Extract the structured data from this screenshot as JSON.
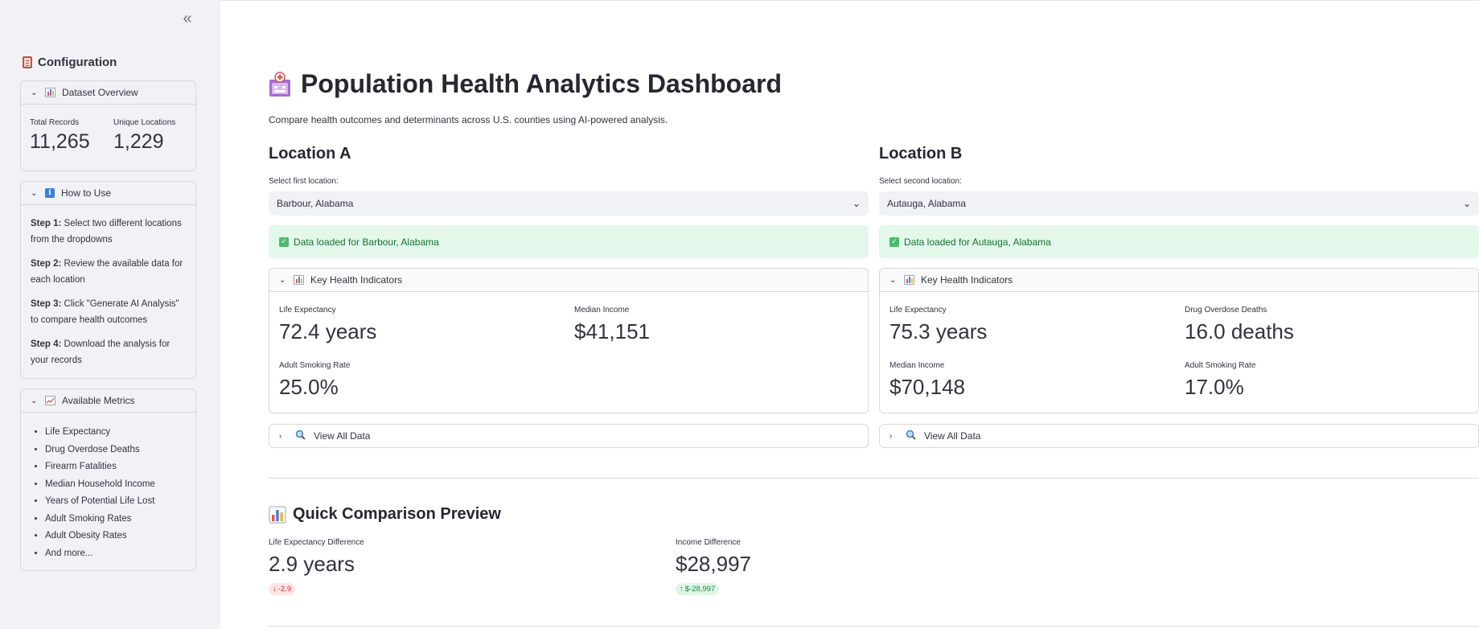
{
  "sidebar": {
    "collapse_icon": "double-chevron-left-icon",
    "title": "Configuration",
    "dataset": {
      "header": "Dataset Overview",
      "metrics": [
        {
          "label": "Total Records",
          "value": "11,265"
        },
        {
          "label": "Unique Locations",
          "value": "1,229"
        }
      ]
    },
    "how_to": {
      "header": "How to Use",
      "steps": [
        {
          "label": "Step 1:",
          "text": "Select two different locations from the dropdowns"
        },
        {
          "label": "Step 2:",
          "text": "Review the available data for each location"
        },
        {
          "label": "Step 3:",
          "text": "Click \"Generate AI Analysis\" to compare health outcomes"
        },
        {
          "label": "Step 4:",
          "text": "Download the analysis for your records"
        }
      ]
    },
    "metrics_list": {
      "header": "Available Metrics",
      "items": [
        "Life Expectancy",
        "Drug Overdose Deaths",
        "Firearm Fatalities",
        "Median Household Income",
        "Years of Potential Life Lost",
        "Adult Smoking Rates",
        "Adult Obesity Rates",
        "And more..."
      ]
    }
  },
  "main": {
    "title": "Population Health Analytics Dashboard",
    "subtitle": "Compare health outcomes and determinants across U.S. counties using AI-powered analysis.",
    "location_a": {
      "heading": "Location A",
      "select_label": "Select first location:",
      "selected": "Barbour, Alabama",
      "success": "Data loaded for Barbour, Alabama",
      "kpi_header": "Key Health Indicators",
      "kpis": [
        {
          "label": "Life Expectancy",
          "value": "72.4 years"
        },
        {
          "label": "Median Income",
          "value": "$41,151"
        },
        {
          "label": "Adult Smoking Rate",
          "value": "25.0%"
        }
      ],
      "view_all": "View All Data"
    },
    "location_b": {
      "heading": "Location B",
      "select_label": "Select second location:",
      "selected": "Autauga, Alabama",
      "success": "Data loaded for Autauga, Alabama",
      "kpi_header": "Key Health Indicators",
      "kpis": [
        {
          "label": "Life Expectancy",
          "value": "75.3 years"
        },
        {
          "label": "Drug Overdose Deaths",
          "value": "16.0 deaths"
        },
        {
          "label": "Median Income",
          "value": "$70,148"
        },
        {
          "label": "Adult Smoking Rate",
          "value": "17.0%"
        }
      ],
      "view_all": "View All Data"
    },
    "comparison": {
      "title": "Quick Comparison Preview",
      "items": [
        {
          "label": "Life Expectancy Difference",
          "value": "2.9 years",
          "delta": "-2.9",
          "delta_dir": "down",
          "delta_color": "#d3292f"
        },
        {
          "label": "Income Difference",
          "value": "$28,997",
          "delta": "$-28,997",
          "delta_dir": "up",
          "delta_color": "#1b8a3e"
        }
      ]
    }
  },
  "colors": {
    "sidebar_bg": "#f0f2f6",
    "success_bg": "#e3f7ea",
    "success_text": "#177233"
  }
}
